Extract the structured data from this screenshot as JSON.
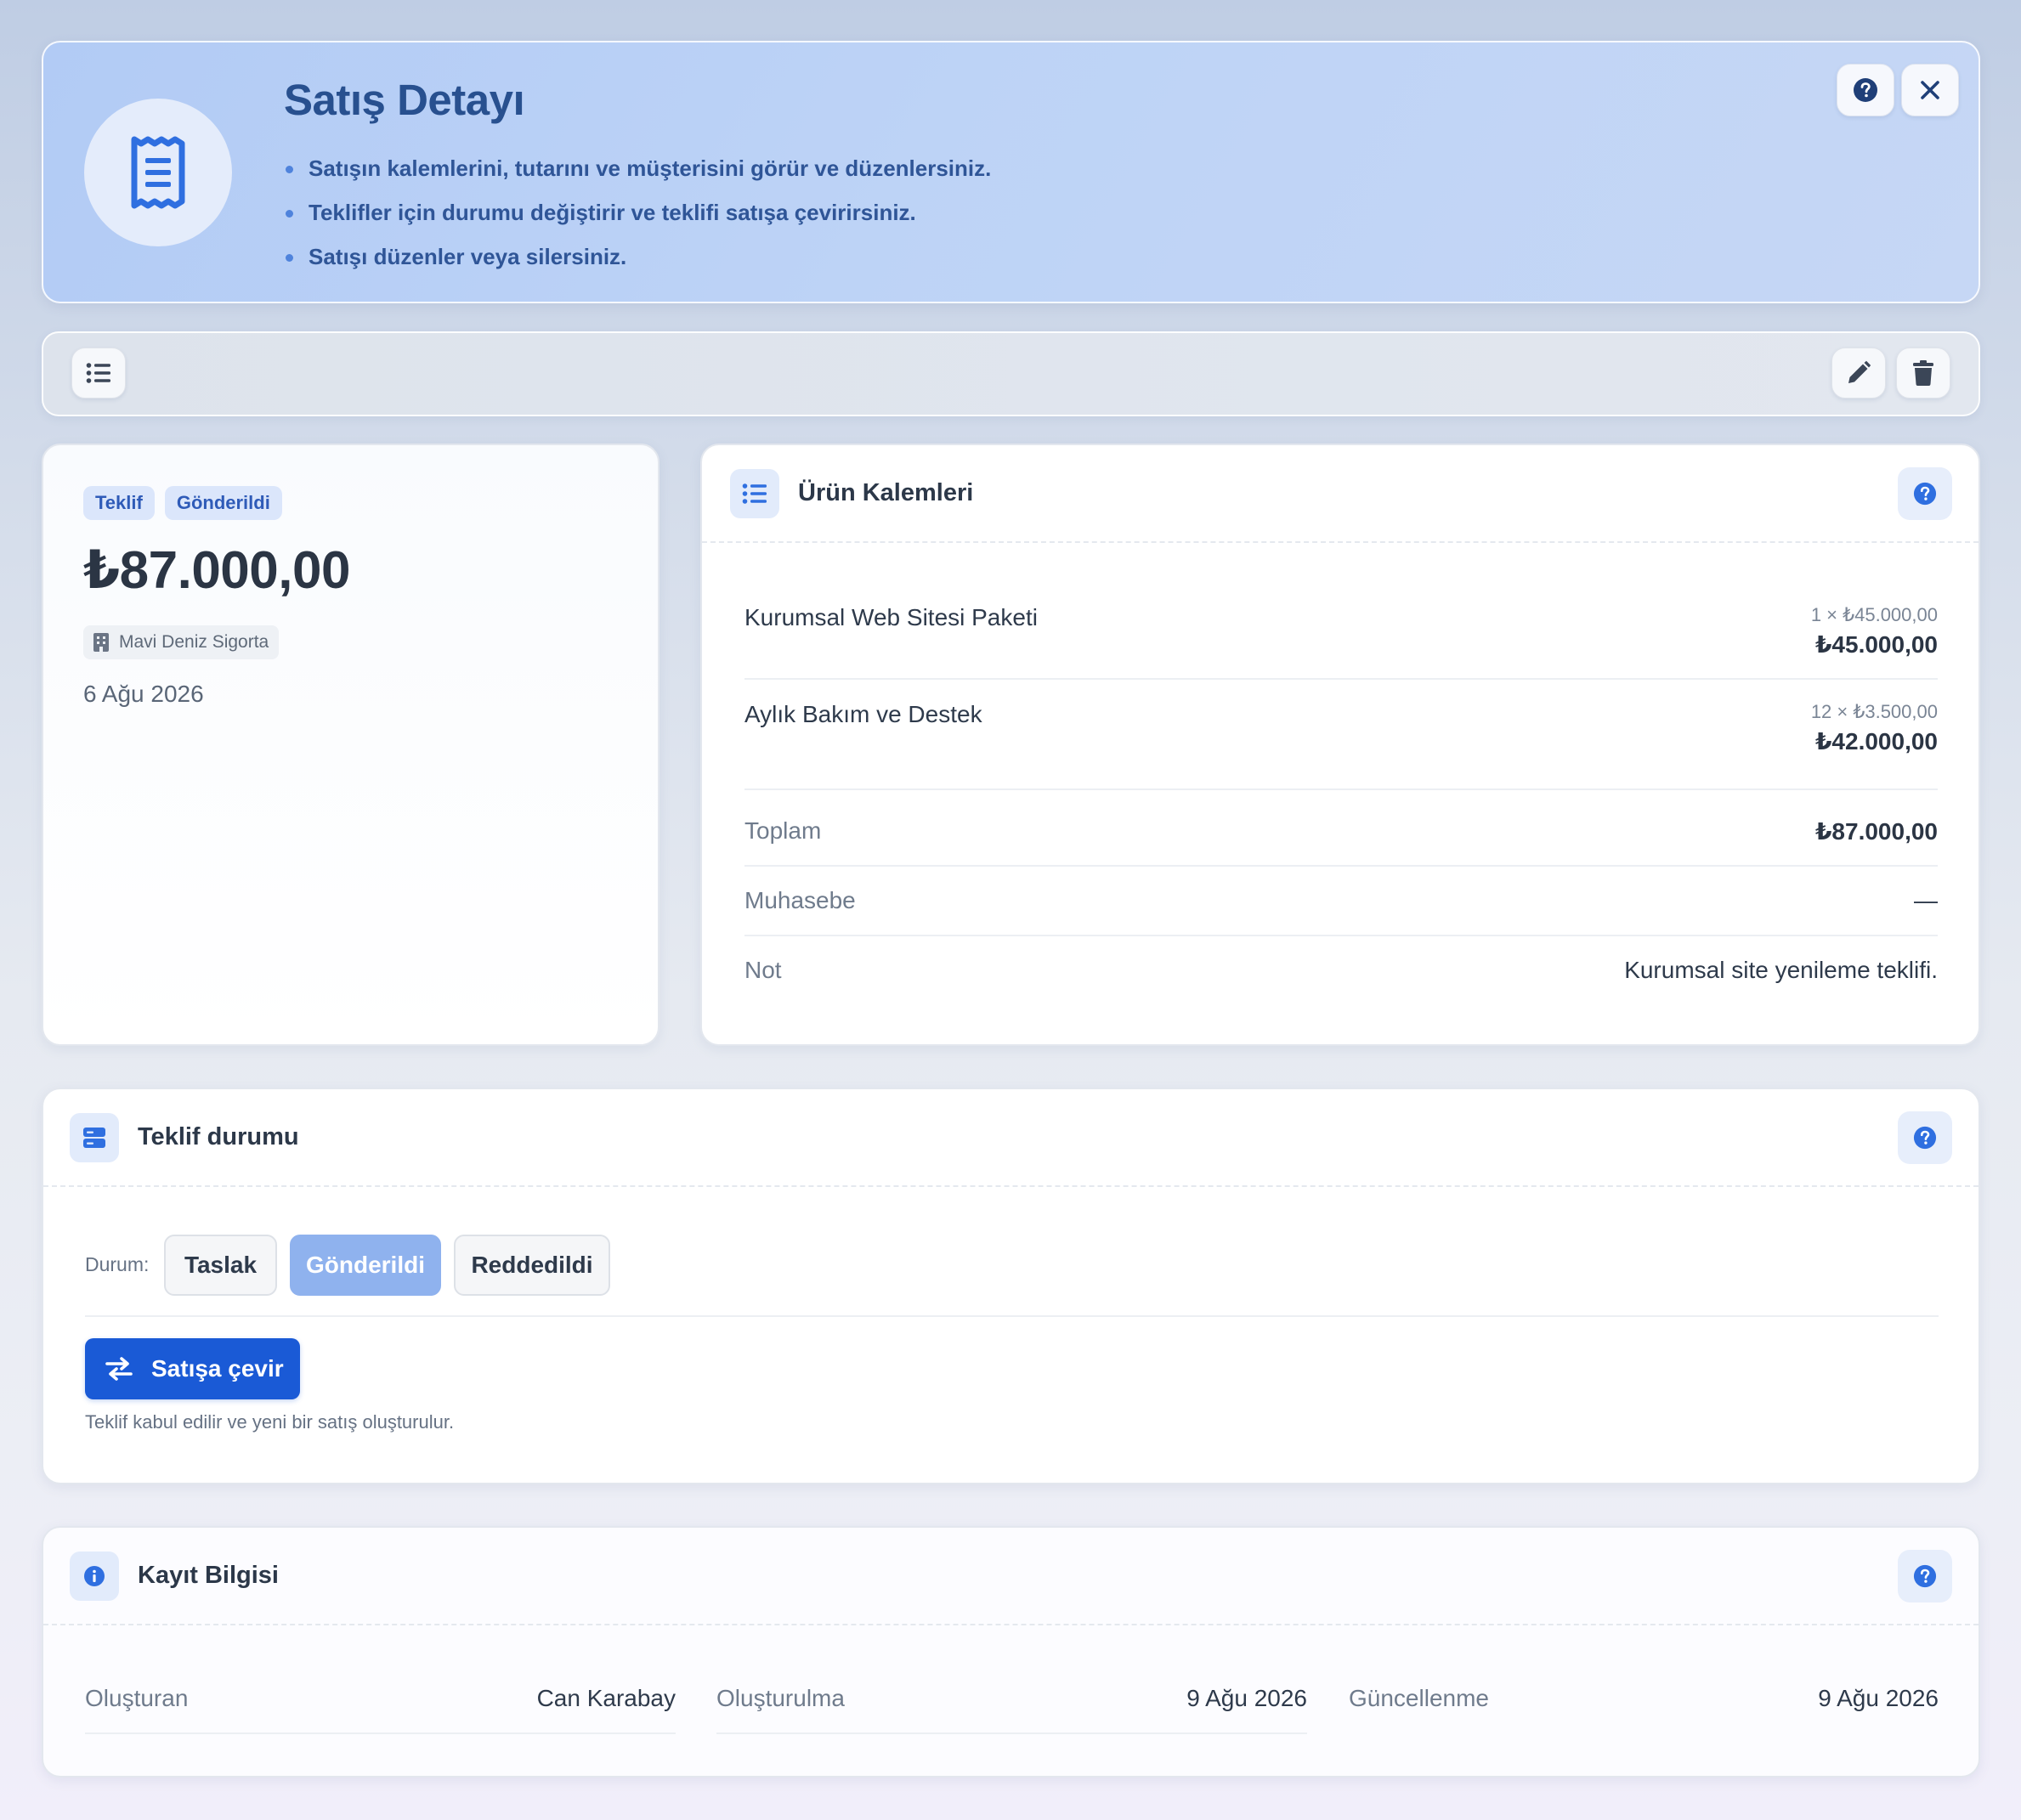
{
  "header": {
    "title": "Satış Detayı",
    "bullets": [
      "Satışın kalemlerini, tutarını ve müşterisini görür ve düzenlersiniz.",
      "Teklifler için durumu değiştirir ve teklifi satışa çevirirsiniz.",
      "Satışı düzenler veya silersiniz."
    ],
    "help_icon": "question-circle-icon",
    "close_icon": "close-icon"
  },
  "toolbar": {
    "list_icon": "list-icon",
    "edit_icon": "pencil-icon",
    "delete_icon": "trash-icon"
  },
  "summary": {
    "badges": [
      "Teklif",
      "Gönderildi"
    ],
    "amount": "₺87.000,00",
    "customer": "Mavi Deniz Sigorta",
    "date": "6 Ağu 2026"
  },
  "items_card": {
    "title": "Ürün Kalemleri",
    "items": [
      {
        "name": "Kurumsal Web Sitesi Paketi",
        "qty": "1 × ₺45.000,00",
        "total": "₺45.000,00"
      },
      {
        "name": "Aylık Bakım ve Destek",
        "qty": "12 × ₺3.500,00",
        "total": "₺42.000,00"
      }
    ],
    "rows": [
      {
        "label": "Toplam",
        "value": "₺87.000,00"
      },
      {
        "label": "Muhasebe",
        "value": "—"
      },
      {
        "label": "Not",
        "value": "Kurumsal site yenileme teklifi."
      }
    ]
  },
  "status_card": {
    "title": "Teklif durumu",
    "label": "Durum:",
    "options": [
      "Taslak",
      "Gönderildi",
      "Reddedildi"
    ],
    "selected": "Gönderildi",
    "convert_label": "Satışa çevir",
    "hint": "Teklif kabul edilir ve yeni bir satış oluşturulur."
  },
  "record_card": {
    "title": "Kayıt Bilgisi",
    "fields": [
      {
        "label": "Oluşturan",
        "value": "Can Karabay"
      },
      {
        "label": "Oluşturulma",
        "value": "9 Ağu 2026"
      },
      {
        "label": "Güncellenme",
        "value": "9 Ağu 2026"
      }
    ]
  },
  "colors": {
    "accent": "#1a5ad6",
    "title_blue": "#28508f",
    "badge_bg": "#dbe6fb",
    "selected_option": "#8fb2ee"
  }
}
